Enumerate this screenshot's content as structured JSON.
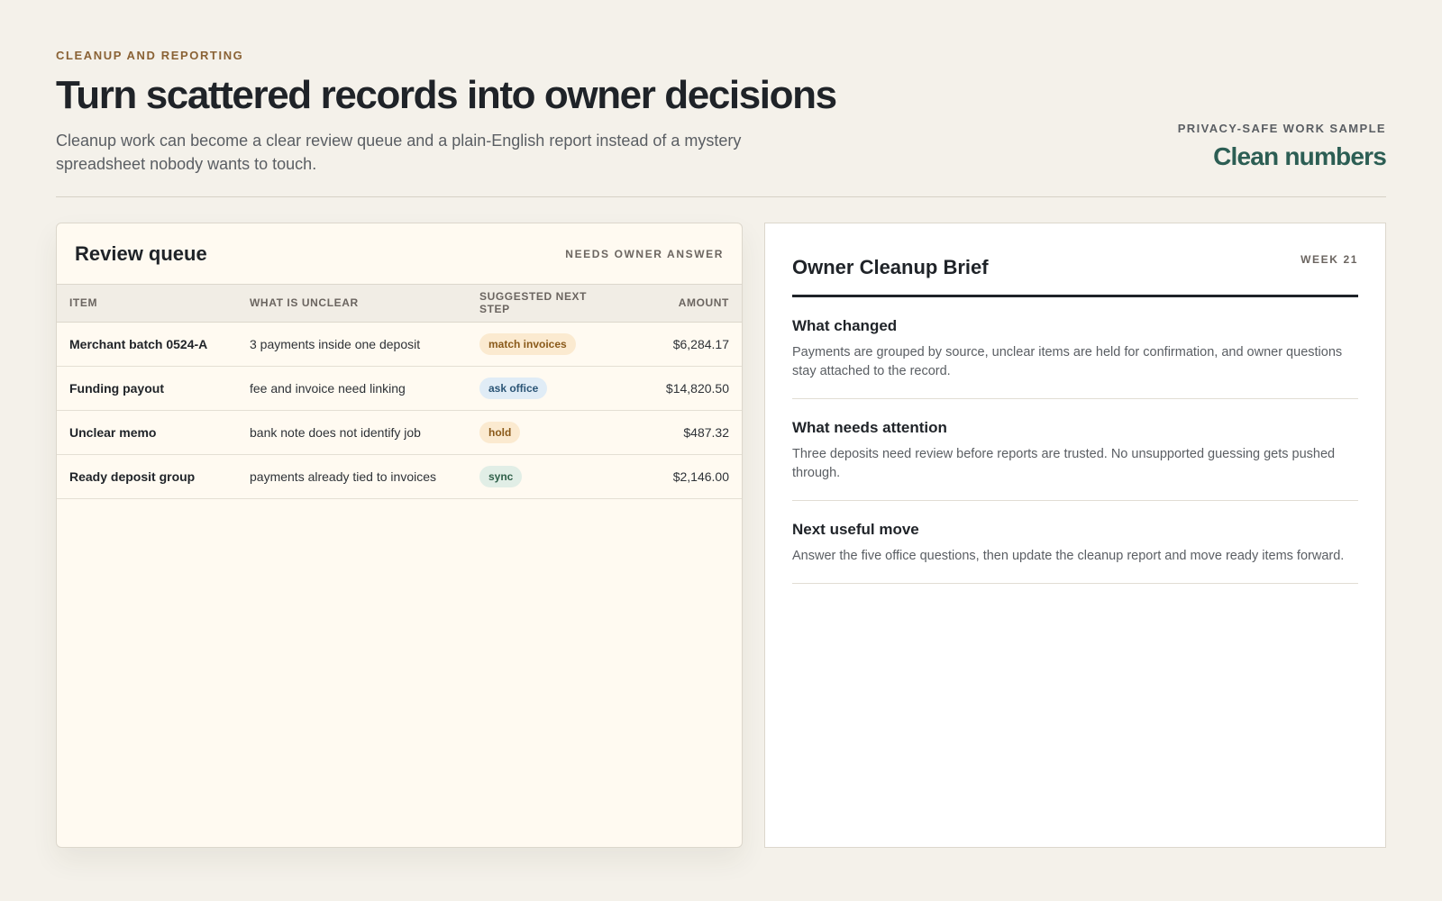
{
  "header": {
    "eyebrow": "CLEANUP AND REPORTING",
    "title": "Turn scattered records into owner decisions",
    "subtitle": "Cleanup work can become a clear review queue and a plain-English report instead of a mystery spreadsheet nobody wants to touch.",
    "sample_label": "PRIVACY-SAFE WORK SAMPLE",
    "sample_value": "Clean numbers"
  },
  "queue": {
    "title": "Review queue",
    "flag": "NEEDS OWNER ANSWER",
    "columns": [
      "ITEM",
      "WHAT IS UNCLEAR",
      "SUGGESTED NEXT STEP",
      "AMOUNT"
    ],
    "rows": [
      {
        "item": "Merchant batch 0524-A",
        "unclear": "3 payments inside one deposit",
        "step": "match invoices",
        "amount": "$6,284.17"
      },
      {
        "item": "Funding payout",
        "unclear": "fee and invoice need linking",
        "step": "ask office",
        "amount": "$14,820.50"
      },
      {
        "item": "Unclear memo",
        "unclear": "bank note does not identify job",
        "step": "hold",
        "amount": "$487.32"
      },
      {
        "item": "Ready deposit group",
        "unclear": "payments already tied to invoices",
        "step": "sync",
        "amount": "$2,146.00"
      }
    ]
  },
  "brief": {
    "title": "Owner Cleanup Brief",
    "week": "WEEK 21",
    "sections": [
      {
        "heading": "What changed",
        "body": "Payments are grouped by source, unclear items are held for confirmation, and owner questions stay attached to the record."
      },
      {
        "heading": "What needs attention",
        "body": "Three deposits need review before reports are trusted. No unsupported guessing gets pushed through."
      },
      {
        "heading": "Next useful move",
        "body": "Answer the five office questions, then update the cleanup report and move ready items forward."
      }
    ]
  },
  "colors": {
    "background": "#f4f1ea",
    "eyebrow": "#8a6235",
    "accent": "#2c5e54",
    "pill_amber": "#fbead0",
    "pill_blue": "#e0ecf6",
    "pill_green": "#e1eee6"
  }
}
